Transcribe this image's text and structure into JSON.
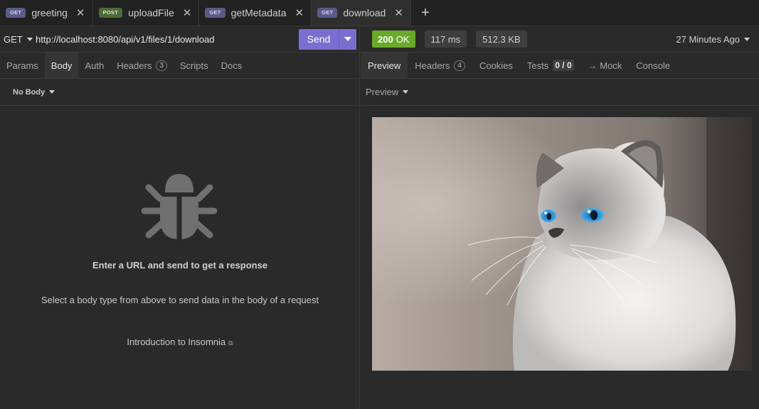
{
  "tabs": [
    {
      "method": "GET",
      "name": "greeting",
      "active": false
    },
    {
      "method": "POST",
      "name": "uploadFile",
      "active": false
    },
    {
      "method": "GET",
      "name": "getMetadata",
      "active": false
    },
    {
      "method": "GET",
      "name": "download",
      "active": true
    }
  ],
  "tab_close": "✕",
  "new_tab": "+",
  "request": {
    "method": "GET",
    "url": "http://localhost:8080/api/v1/files/1/download",
    "send_label": "Send",
    "tabs": [
      {
        "label": "Params"
      },
      {
        "label": "Body",
        "active": true
      },
      {
        "label": "Auth"
      },
      {
        "label": "Headers",
        "badge": "3"
      },
      {
        "label": "Scripts"
      },
      {
        "label": "Docs"
      }
    ],
    "body_type": "No Body",
    "empty_title": "Enter a URL and send to get a response",
    "empty_desc": "Select a body type from above to send data in the body of a request",
    "intro_link": "Introduction to Insomnia",
    "intro_icon": "external-link-icon"
  },
  "response": {
    "status_code": "200",
    "status_text": "OK",
    "time": "117 ms",
    "size": "512.3 KB",
    "ago": "27 Minutes Ago",
    "tabs": [
      {
        "label": "Preview",
        "active": true
      },
      {
        "label": "Headers",
        "badge": "4"
      },
      {
        "label": "Cookies"
      },
      {
        "label": "Tests",
        "score": "0 / 0"
      },
      {
        "label": "→ Mock"
      },
      {
        "label": "Console"
      }
    ],
    "preview_mode": "Preview",
    "image_subject": "cat-photo"
  },
  "colors": {
    "accent": "#7a6fd0",
    "status_ok": "#6aaa2a",
    "background": "#2a2a2a"
  }
}
